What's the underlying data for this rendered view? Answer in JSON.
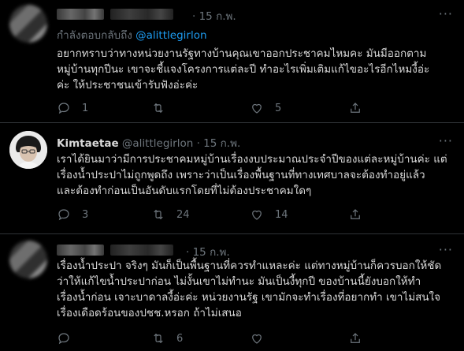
{
  "tweets": [
    {
      "time": "15 ก.พ.",
      "replying_prefix": "กำลังตอบกลับถึง",
      "replying_to": "@alittlegirlon",
      "lines": [
        "อยากทราบว่าทางหน่วยงานรัฐทางบ้านคุณเขาออกประชาคมไหมคะ มันมีออกตาม",
        "หมู่บ้านทุกปีนะ เขาจะชี้แจงโครงการแต่ละปี ทำอะไรเพิ่มเติมแก้ไขอะไรอีกไหมงี้อ่ะ",
        "ค่ะ ให้ประชาชนเข้ารับฟังอ่ะค่ะ"
      ],
      "replies": "1",
      "retweets": "",
      "likes": "5",
      "more": "···"
    },
    {
      "display_name": "Kimtaetae",
      "handle": "@alittlegirlon",
      "separator": "·",
      "time": "15 ก.พ.",
      "lines": [
        "เราได้ยินมาว่ามีการประชาคมหมู่บ้านเรื่องงบประมาณประจำปีของแต่ละหมู่บ้านค่ะ แต่",
        "เรื่องน้ำประปาไม่ถูกพูดถึง เพราะว่าเป็นเรื่องพื้นฐานที่ทางเทศบาลจะต้องทำอยู่แล้ว",
        "และต้องทำก่อนเป็นอันดับแรกโดยที่ไม่ต้องประชาคมใดๆ"
      ],
      "replies": "3",
      "retweets": "24",
      "likes": "14",
      "more": "···"
    },
    {
      "time": "15 ก.พ.",
      "lines": [
        "เรื่องน้ำประปา จริงๆ มันก็เป็นพื้นฐานที่ควรทำแหละค่ะ แต่ทางหมู่บ้านก็ควรบอกให้ชัด",
        "ว่าให้แก้ไขน้ำประปาก่อน ไม่งั้นเขาไม่ทำนะ มันเป็นงี้ทุกปี ของบ้านนี้ยังบอกให้ทำ",
        "เรื่องน้ำก่อน เจาะบาดาลงี้อ่ะค่ะ หน่วยงานรัฐ เขามักจะทำเรื่องที่อยากทำ เขาไม่สนใจ",
        "เรื่องเดือดร้อนของปชช.หรอก ถ้าไม่เสนอ"
      ],
      "replies": "",
      "retweets": "6",
      "likes": "",
      "more": "···"
    }
  ],
  "icons": [
    "reply-icon",
    "retweet-icon",
    "like-icon",
    "share-icon",
    "more-icon"
  ],
  "colors": {
    "background": "#000000",
    "text": "#d9d9d9",
    "muted": "#6e767d",
    "link": "#1d9bf0",
    "divider": "#2f3336"
  }
}
